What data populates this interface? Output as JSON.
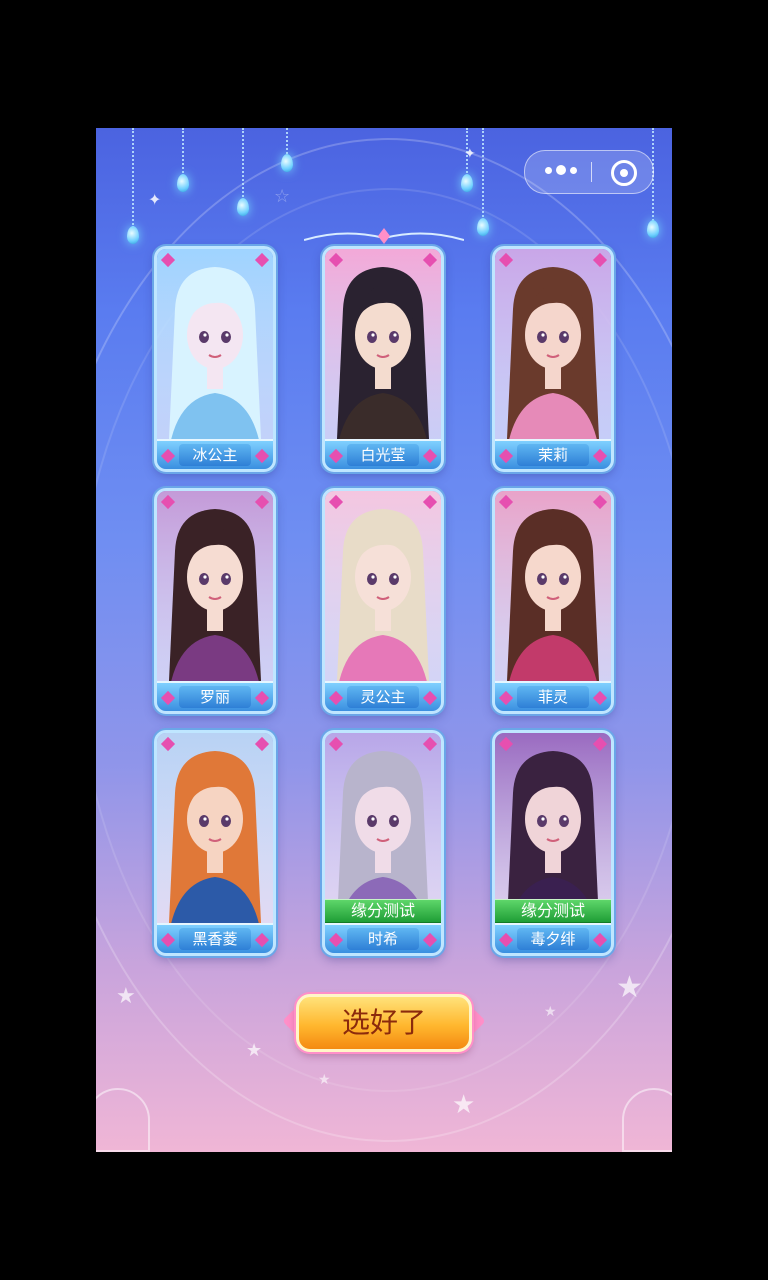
{
  "capsule": {
    "more_icon": "more-dots-icon",
    "close_icon": "target-icon"
  },
  "characters": [
    {
      "name": "冰公主",
      "palette": {
        "bg": "#9fd4ff",
        "hair": "#d8f3ff",
        "skin": "#f4e6f2",
        "dress": "#7fc2f0"
      },
      "badge": ""
    },
    {
      "name": "白光莹",
      "palette": {
        "bg": "#f3a9d8",
        "hair": "#2a2230",
        "skin": "#f4dccf",
        "dress": "#3a2c2a"
      },
      "badge": ""
    },
    {
      "name": "茉莉",
      "palette": {
        "bg": "#c9a6e8",
        "hair": "#6a3a2c",
        "skin": "#f5d6cc",
        "dress": "#e68ab8"
      },
      "badge": ""
    },
    {
      "name": "罗丽",
      "palette": {
        "bg": "#c49ad8",
        "hair": "#3a2226",
        "skin": "#f6dcd2",
        "dress": "#7a3a82"
      },
      "badge": ""
    },
    {
      "name": "灵公主",
      "palette": {
        "bg": "#f4c6e0",
        "hair": "#e8dcc8",
        "skin": "#f6e0d8",
        "dress": "#e678b8"
      },
      "badge": ""
    },
    {
      "name": "菲灵",
      "palette": {
        "bg": "#e9a3c9",
        "hair": "#5a2e26",
        "skin": "#f6d8cc",
        "dress": "#c23a6a"
      },
      "badge": ""
    },
    {
      "name": "黑香菱",
      "palette": {
        "bg": "#b8d2f4",
        "hair": "#e07838",
        "skin": "#f6d4c2",
        "dress": "#2c5aa8"
      },
      "badge": ""
    },
    {
      "name": "时希",
      "palette": {
        "bg": "#b8a6e8",
        "hair": "#b8b4cc",
        "skin": "#f0dce8",
        "dress": "#8c6ab8"
      },
      "badge": "缘分测试"
    },
    {
      "name": "毒夕绯",
      "palette": {
        "bg": "#9a6ac0",
        "hair": "#3a2240",
        "skin": "#f0d4d8",
        "dress": "#3a2050"
      },
      "badge": "缘分测试"
    }
  ],
  "confirm_label": "选好了"
}
